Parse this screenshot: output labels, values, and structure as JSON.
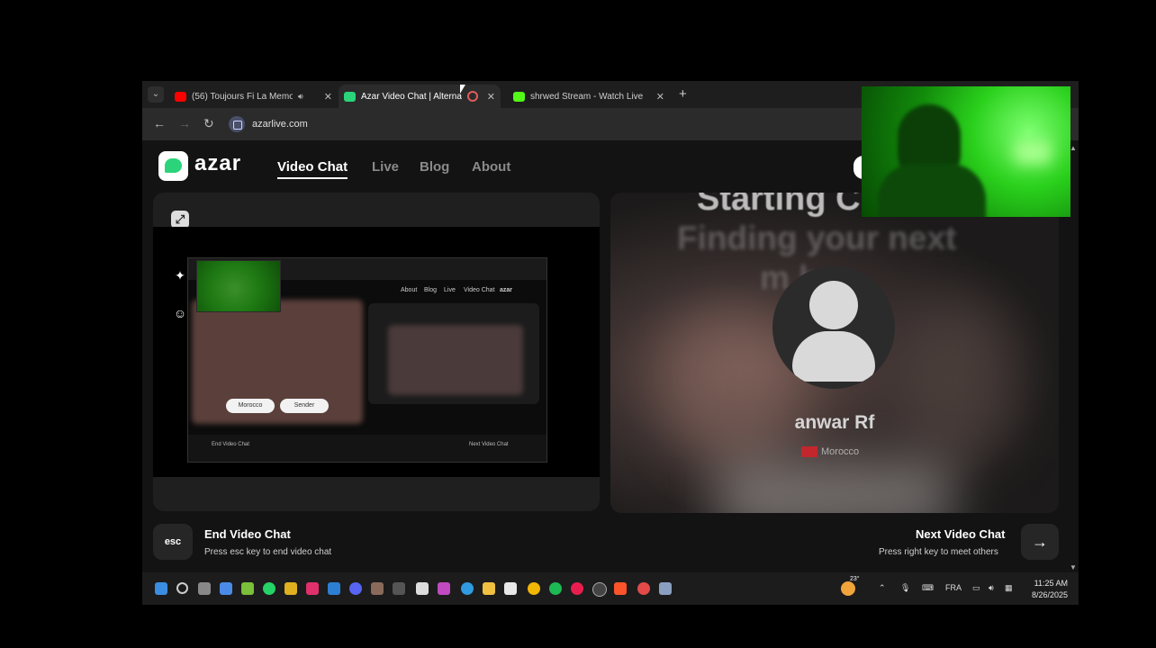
{
  "browser": {
    "tabs": [
      {
        "title": "(56) Toujours Fi La Memoir",
        "favicon_color": "#ff0000",
        "active": false
      },
      {
        "title": "Azar Video Chat | Alternati",
        "favicon_color": "#2bd47a",
        "active": true
      },
      {
        "title": "shrwed Stream - Watch Live on",
        "favicon_color": "#53fc18",
        "active": false
      }
    ],
    "new_tab": "+",
    "url": "azarlive.com"
  },
  "site": {
    "logo": "azar",
    "nav": [
      "Video Chat",
      "Live",
      "Blog",
      "About"
    ],
    "active_nav": "Video Chat"
  },
  "peer": {
    "status_heading": "Starting C",
    "status_sub_1": "Finding your next",
    "status_sub_2": "m   h.",
    "name": "anwar Rf",
    "country": "Morocco",
    "flag_color": "#c1272d"
  },
  "mini_screen": {
    "logo": "azar",
    "nav": [
      "Video Chat",
      "Live",
      "Blog",
      "About"
    ],
    "chip_left": "Morocco",
    "chip_right": "Sender",
    "footer_left": "End Video Chat",
    "footer_right": "Next Video Chat"
  },
  "actions": {
    "esc_key": "esc",
    "end_title": "End Video Chat",
    "end_sub": "Press esc key to end video chat",
    "next_title": "Next Video Chat",
    "next_sub": "Press right key to meet others",
    "next_arrow": "→"
  },
  "taskbar": {
    "weather_temp": "23°",
    "lang": "FRA",
    "time": "11:25 AM",
    "date": "8/26/2025"
  },
  "icons": {
    "expand": "expand-icon",
    "sparkle": "sparkle-icon",
    "smiley": "smiley-icon"
  }
}
